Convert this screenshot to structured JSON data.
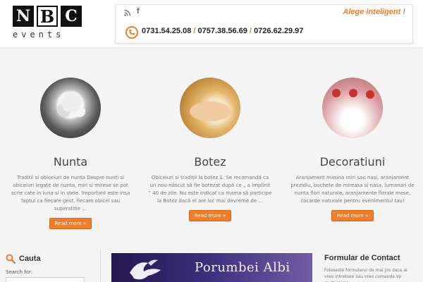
{
  "header": {
    "logo_letters": [
      "N",
      "B",
      "C"
    ],
    "logo_subtitle": "events",
    "slogan": "Alege inteligent !",
    "social": {
      "fb_label": "f"
    },
    "phones": [
      "0731.54.25.08",
      "0757.38.56.69",
      "0726.62.29.97"
    ],
    "phone_separator": " / "
  },
  "services": [
    {
      "title": "Nunta",
      "description": "Traditii si obiceiuri de nunta Despre nunti si obiceiuri legate de nunta, miri si mirese se pot scrie cate in luna si in stele. Important este insa faptul ca fiecare gest, fiecare obicei sau superstitie ...",
      "button": "Read more »"
    },
    {
      "title": "Botez",
      "description": "Obiceiuri si tradiții la botez 1. Se recomandă ca un nou-născut să fie botezat după ce „ a împlinit “ 40 de zile. Nu este indicat ca mama să participe la Botez dacă el are loc mai devreme de ...",
      "button": "Read more »"
    },
    {
      "title": "Decoratiuni",
      "description": "Aranjament masina miri sau nasi, aranjament prezidiu, buchete de mireasa si nasa, lumanari de nunta flori naturale, aranjamente florale mese, cocarde naturale pentru evenimentul tau!",
      "button": "Read more »"
    }
  ],
  "search": {
    "title": "Cauta",
    "label": "Search for:",
    "value": ""
  },
  "banner": {
    "title": "Porumbei Albi"
  },
  "contact": {
    "title": "Formular de Contact",
    "text": "Foloseste formularul de mai jos daca ai vreo intrebare sau vreo comanda.Va multumim!"
  },
  "colors": {
    "accent": "#ef7d2b",
    "text_dark": "#333333",
    "banner": "#2c2166"
  }
}
